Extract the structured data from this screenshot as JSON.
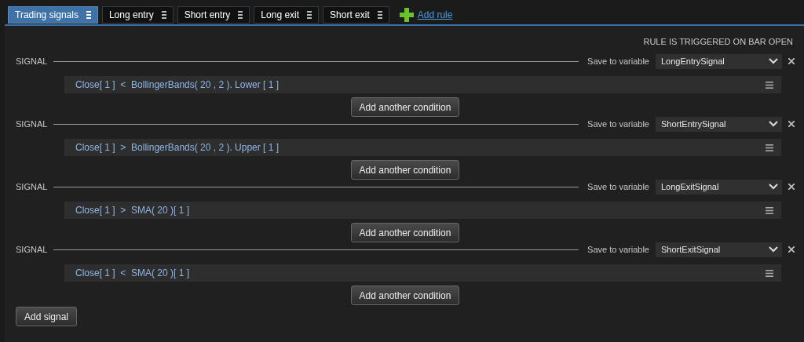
{
  "tabs": [
    {
      "label": "Trading signals",
      "selected": true
    },
    {
      "label": "Long entry",
      "selected": false
    },
    {
      "label": "Short entry",
      "selected": false
    },
    {
      "label": "Long exit",
      "selected": false
    },
    {
      "label": "Short exit",
      "selected": false
    }
  ],
  "add_rule": "Add rule",
  "trigger_note": "RULE IS TRIGGERED ON BAR OPEN",
  "signals": [
    {
      "label": "SIGNAL",
      "save_label": "Save to variable",
      "variable": "LongEntrySignal",
      "conditions": [
        "Close[ 1 ]  <  BollingerBands( 20 , 2 ). Lower [ 1 ]"
      ],
      "add_condition": "Add another condition"
    },
    {
      "label": "SIGNAL",
      "save_label": "Save to variable",
      "variable": "ShortEntrySignal",
      "conditions": [
        "Close[ 1 ]  >  BollingerBands( 20 , 2 ). Upper [ 1 ]"
      ],
      "add_condition": "Add another condition"
    },
    {
      "label": "SIGNAL",
      "save_label": "Save to variable",
      "variable": "LongExitSignal",
      "conditions": [
        "Close[ 1 ]  >  SMA( 20 )[ 1 ]"
      ],
      "add_condition": "Add another condition"
    },
    {
      "label": "SIGNAL",
      "save_label": "Save to variable",
      "variable": "ShortExitSignal",
      "conditions": [
        "Close[ 1 ]  <  SMA( 20 )[ 1 ]"
      ],
      "add_condition": "Add another condition"
    }
  ],
  "add_signal": "Add signal"
}
